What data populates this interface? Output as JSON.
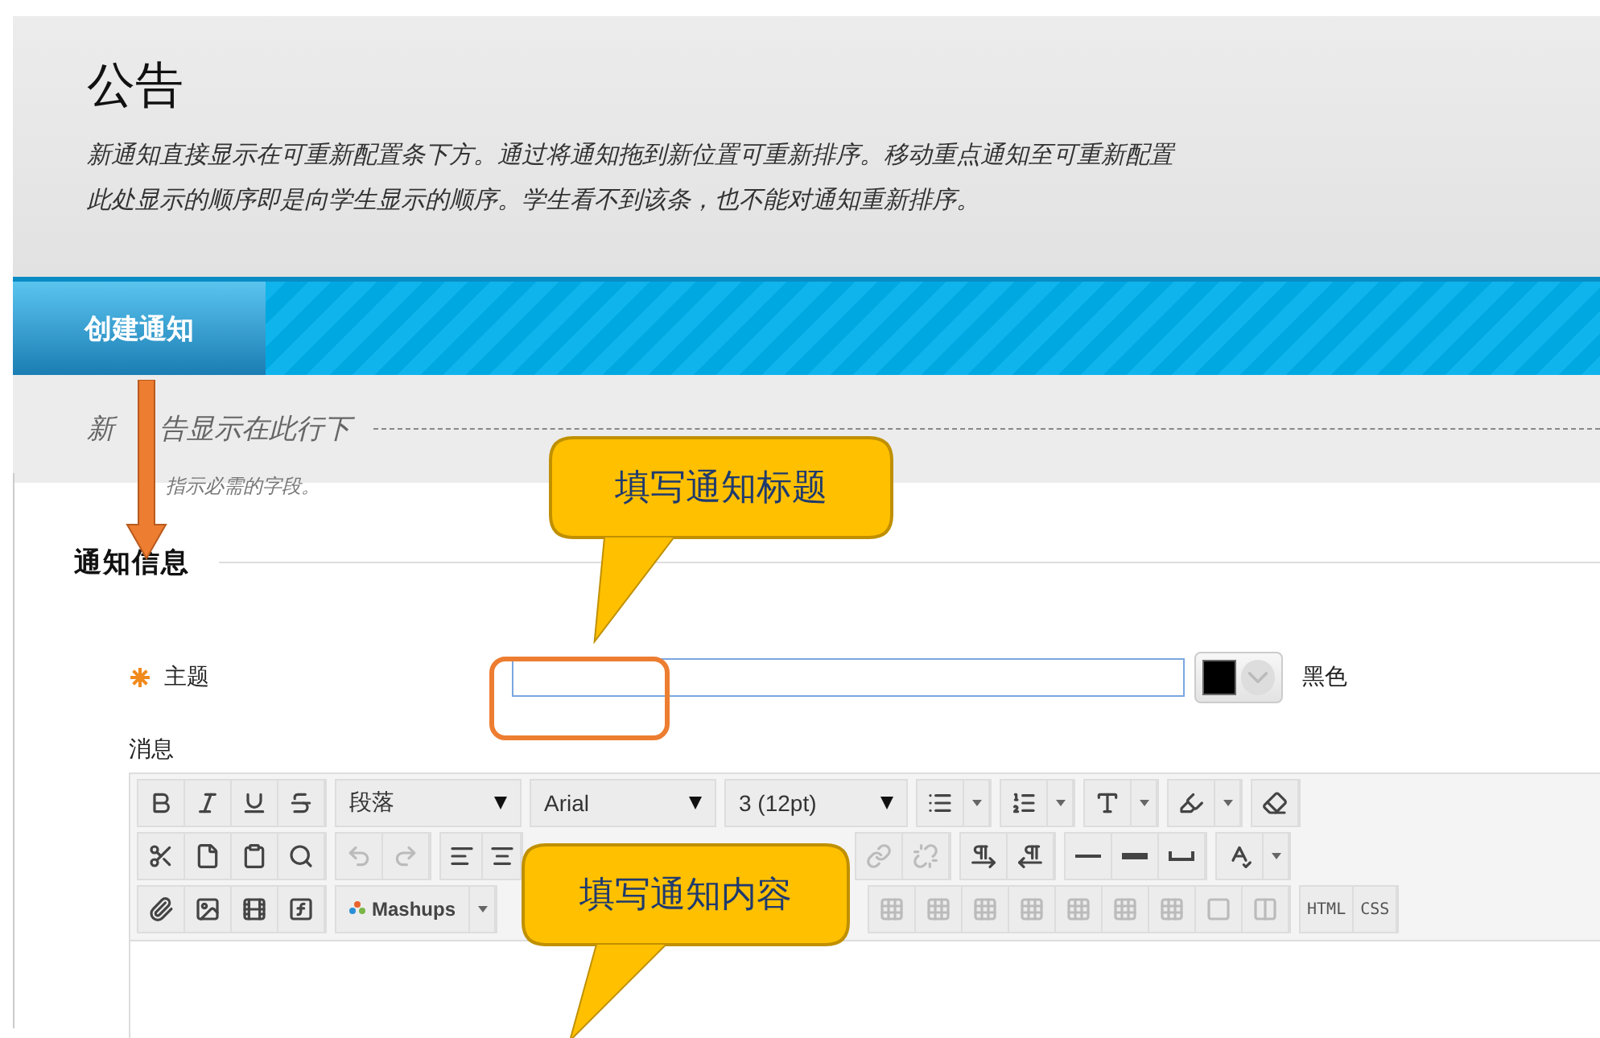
{
  "page": {
    "title": "公告",
    "description": [
      "新通知直接显示在可重新配置条下方。通过将通知拖到新位置可重新排序。移动重点通知至可重新配置",
      "此处显示的顺序即是向学生显示的顺序。学生看不到该条，也不能对通知重新排序。"
    ]
  },
  "action_bar": {
    "tabs": [
      {
        "label": "创建通知",
        "selected": true
      }
    ]
  },
  "divider_label": [
    "新",
    "告显示在此行下"
  ],
  "required_note": "指示必需的字段。",
  "section_title": "通知信息",
  "subject": {
    "label": "主题",
    "required": true,
    "focused": true,
    "color": "#000000",
    "color_label": "黑色"
  },
  "message_label": "消息",
  "editor": {
    "format": "段落",
    "font": "Arial",
    "size": "3 (12pt)",
    "mashups": "Mashups",
    "html": "HTML",
    "css": "CSS"
  },
  "annotations": [
    {
      "text": "填写通知标题"
    },
    {
      "text": "填写通知内容"
    }
  ]
}
